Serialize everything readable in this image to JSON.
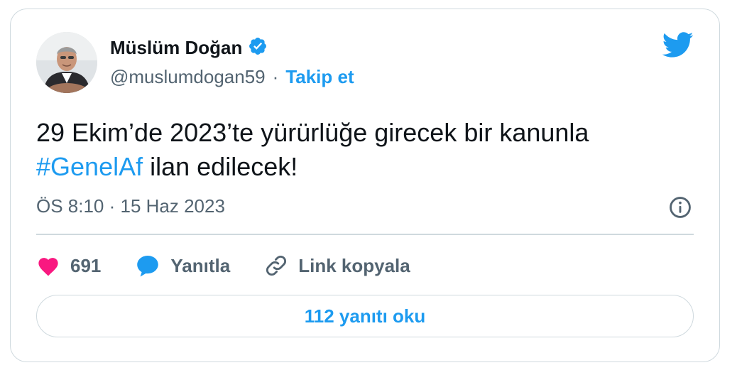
{
  "author": {
    "name": "Müslüm Doğan",
    "handle": "@muslumdogan59",
    "separator": "·",
    "follow_label": "Takip et",
    "verified_icon": "verified-badge-icon",
    "avatar_icon": "profile-photo"
  },
  "tweet": {
    "text_line1": "29 Ekim’de 2023’te yürürlüğe girecek bir kanunla",
    "hashtag": "#GenelAf",
    "text_rest": " ilan edilecek!",
    "timestamp": "ÖS 8:10 · 15 Haz 2023"
  },
  "actions": {
    "likes_count": "691",
    "reply_label": "Yanıtla",
    "copy_link_label": "Link kopyala"
  },
  "replies_button_label": "112 yanıtı oku",
  "colors": {
    "accent": "#1d9bf0",
    "heart": "#f91880",
    "text": "#0f1419",
    "muted": "#536471",
    "border": "#cfd9de"
  }
}
